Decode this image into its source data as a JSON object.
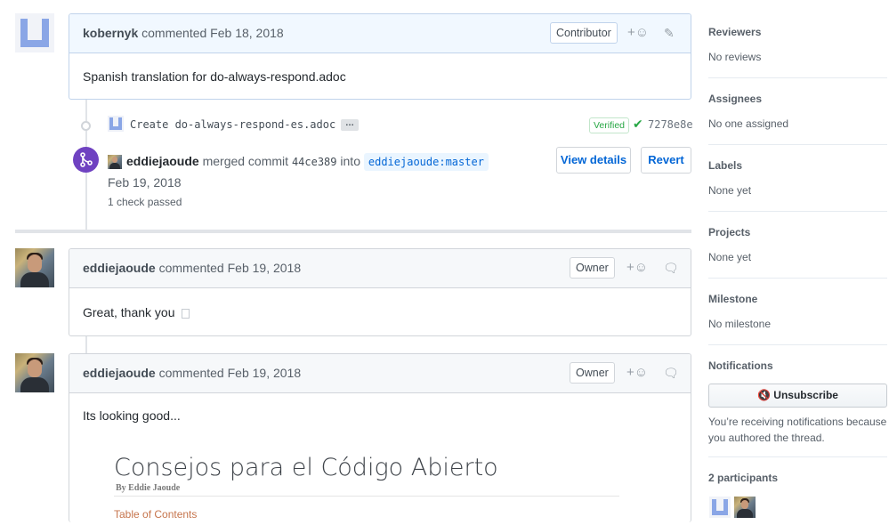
{
  "colors": {
    "link": "#0366d6",
    "merged_purple": "#6f42c1",
    "verified_green": "#28a745"
  },
  "comments": [
    {
      "author": "kobernyk",
      "meta": "commented Feb 18, 2018",
      "badge": "Contributor",
      "body": "Spanish translation for do-always-respond.adoc",
      "avatar": "identicon"
    },
    {
      "author": "eddiejaoude",
      "meta": "commented Feb 19, 2018",
      "badge": "Owner",
      "body": "Great, thank you",
      "avatar": "photo"
    },
    {
      "author": "eddiejaoude",
      "meta": "commented Feb 19, 2018",
      "badge": "Owner",
      "body": "Its looking good...",
      "avatar": "photo"
    }
  ],
  "commit": {
    "message": "Create do-always-respond-es.adoc",
    "more": "…",
    "verified": "Verified",
    "sha": "7278e8e"
  },
  "merge": {
    "author": "eddiejaoude",
    "text_merged": "merged commit",
    "sha": "44ce389",
    "text_into": "into",
    "branch": "eddiejaoude:master",
    "date": "Feb 19, 2018",
    "checks": "1 check passed",
    "view_details": "View details",
    "revert": "Revert"
  },
  "preview": {
    "title": "Consejos para el Código Abierto",
    "byline": "By Eddie Jaoude",
    "toc": "Table of Contents"
  },
  "icons": {
    "reaction": "smiley-icon",
    "edit": "pencil-icon",
    "comment_action": "comment-icon",
    "merge": "merge-icon",
    "mute": "mute-icon",
    "check": "check-icon"
  },
  "sidebar": {
    "reviewers": {
      "title": "Reviewers",
      "value": "No reviews"
    },
    "assignees": {
      "title": "Assignees",
      "value": "No one assigned"
    },
    "labels": {
      "title": "Labels",
      "value": "None yet"
    },
    "projects": {
      "title": "Projects",
      "value": "None yet"
    },
    "milestone": {
      "title": "Milestone",
      "value": "No milestone"
    },
    "notifications": {
      "title": "Notifications",
      "button": "Unsubscribe",
      "reason": "You’re receiving notifications because you authored the thread."
    },
    "participants": {
      "title": "2 participants"
    }
  }
}
